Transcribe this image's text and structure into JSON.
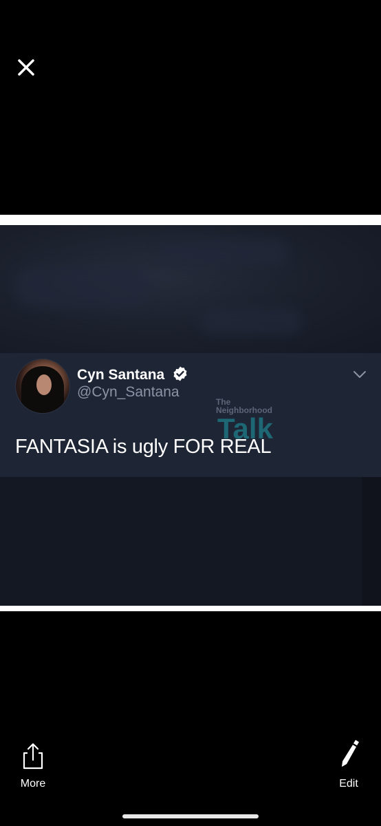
{
  "viewer": {
    "close_icon": "close-icon"
  },
  "tweet": {
    "display_name": "Cyn Santana",
    "handle": "@Cyn_Santana",
    "text": "FANTASIA is ugly FOR REAL",
    "verified_icon": "verified-badge-icon",
    "menu_icon": "chevron-down-icon"
  },
  "watermark": {
    "line1": "The",
    "line2": "Neighborhood",
    "line3": "Talk"
  },
  "toolbar": {
    "more_label": "More",
    "more_icon": "share-icon",
    "edit_label": "Edit",
    "edit_icon": "pencil-icon"
  },
  "colors": {
    "background": "#000000",
    "tweet_card": "#1e2534",
    "handle_gray": "#8b95a6",
    "watermark_teal": "#1f7d8a"
  }
}
